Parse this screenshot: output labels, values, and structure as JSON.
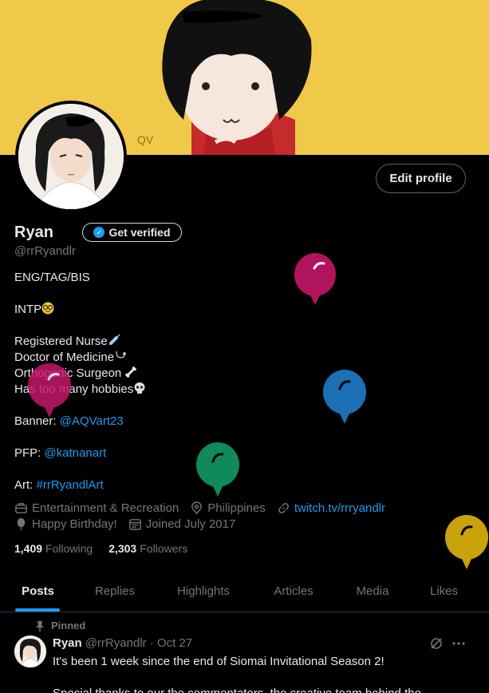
{
  "profile": {
    "name": "Ryan",
    "verify_label": "Get verified",
    "handle": "@rrRyandlr",
    "edit_label": "Edit profile"
  },
  "bio": {
    "line1": "ENG/TAG/BIS",
    "line2": "INTP",
    "line3": "Registered Nurse",
    "line4": "Doctor of Medicine",
    "line5": "Orthopedic Surgeon",
    "line6": "Has too many hobbies",
    "banner_label": "Banner: ",
    "banner_link": "@AQVart23",
    "pfp_label": "PFP: ",
    "pfp_link": "@katnanart",
    "art_label": "Art: ",
    "art_link": "#rrRyandlArt"
  },
  "meta": {
    "category": "Entertainment & Recreation",
    "location": "Philippines",
    "website": "twitch.tv/rrryandlr",
    "birthday": "Happy Birthday!",
    "joined": "Joined July 2017"
  },
  "stats": {
    "following_count": "1,409",
    "following_label": "Following",
    "followers_count": "2,303",
    "followers_label": "Followers"
  },
  "tabs": [
    {
      "label": "Posts"
    },
    {
      "label": "Replies"
    },
    {
      "label": "Highlights"
    },
    {
      "label": "Articles"
    },
    {
      "label": "Media"
    },
    {
      "label": "Likes"
    }
  ],
  "post": {
    "pinned_label": "Pinned",
    "author": "Ryan",
    "handle_date": "@rrRyandlr · Oct 27",
    "text": "It's been 1 week since the end of Siomai Invitational Season 2!",
    "text2": "Special thanks to our the commentators, the creative team behind the"
  },
  "colors": {
    "accent": "#1d9bf0",
    "banner": "#f0c84a",
    "balloon_pink": "#b0145c",
    "balloon_blue": "#1a6fb5",
    "balloon_green": "#0f8a5a",
    "balloon_gold": "#c9a20c"
  },
  "icons": [
    "briefcase-icon",
    "location-icon",
    "link-icon",
    "balloon-icon",
    "calendar-icon",
    "pin-icon",
    "verified-icon",
    "grok-icon",
    "more-icon"
  ]
}
